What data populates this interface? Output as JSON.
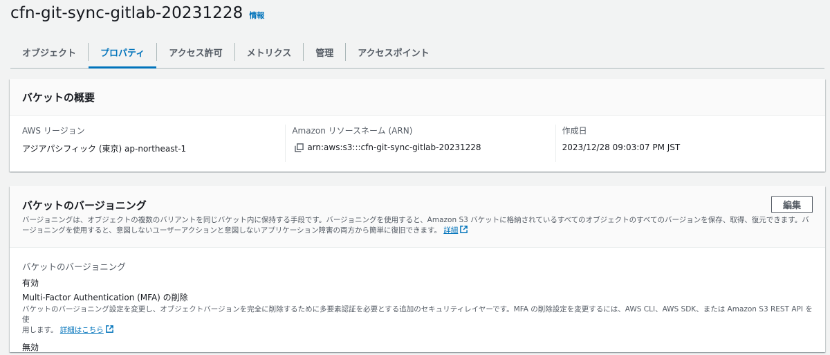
{
  "header": {
    "title": "cfn-git-sync-gitlab-20231228",
    "info": "情報"
  },
  "tabs": [
    {
      "label": "オブジェクト",
      "active": false
    },
    {
      "label": "プロパティ",
      "active": true
    },
    {
      "label": "アクセス許可",
      "active": false
    },
    {
      "label": "メトリクス",
      "active": false
    },
    {
      "label": "管理",
      "active": false
    },
    {
      "label": "アクセスポイント",
      "active": false
    }
  ],
  "overview": {
    "title": "バケットの概要",
    "region_label": "AWS リージョン",
    "region_value": "アジアパシフィック (東京) ap-northeast-1",
    "arn_label": "Amazon リソースネーム (ARN)",
    "arn_value": "arn:aws:s3:::cfn-git-sync-gitlab-20231228",
    "created_label": "作成日",
    "created_value": "2023/12/28 09:03:07 PM JST"
  },
  "versioning": {
    "title": "バケットのバージョニング",
    "edit_label": "編集",
    "description_line1": "バージョニングは、オブジェクトの複数のバリアントを同じバケット内に保持する手段です。バージョニングを使用すると、Amazon S3 バケットに格納されているすべてのオブジェクトのすべてのバージョンを保存、取得、復元できます。バ",
    "description_line2": "ージョニングを使用すると、意図しないユーザーアクションと意図しないアプリケーション障害の両方から簡単に復旧できます。",
    "details_link": "詳細",
    "status_label": "バケットのバージョニング",
    "status_value": "有効",
    "mfa_label": "Multi-Factor Authentication (MFA) の削除",
    "mfa_description_line1": "バケットのバージョニング設定を変更し、オブジェクトバージョンを完全に削除するために多要素認証を必要とする追加のセキュリティレイヤーです。MFA の削除設定を変更するには、AWS CLI、AWS SDK、または Amazon S3 REST API を使",
    "mfa_description_line2": "用します。",
    "mfa_link": "詳細はこちら",
    "mfa_value": "無効"
  },
  "colors": {
    "accent": "#0073bb",
    "background": "#f2f3f3",
    "text": "#16191f",
    "secondary_text": "#545b64"
  },
  "icons": {
    "copy": "copy-icon",
    "external": "external-link-icon"
  }
}
